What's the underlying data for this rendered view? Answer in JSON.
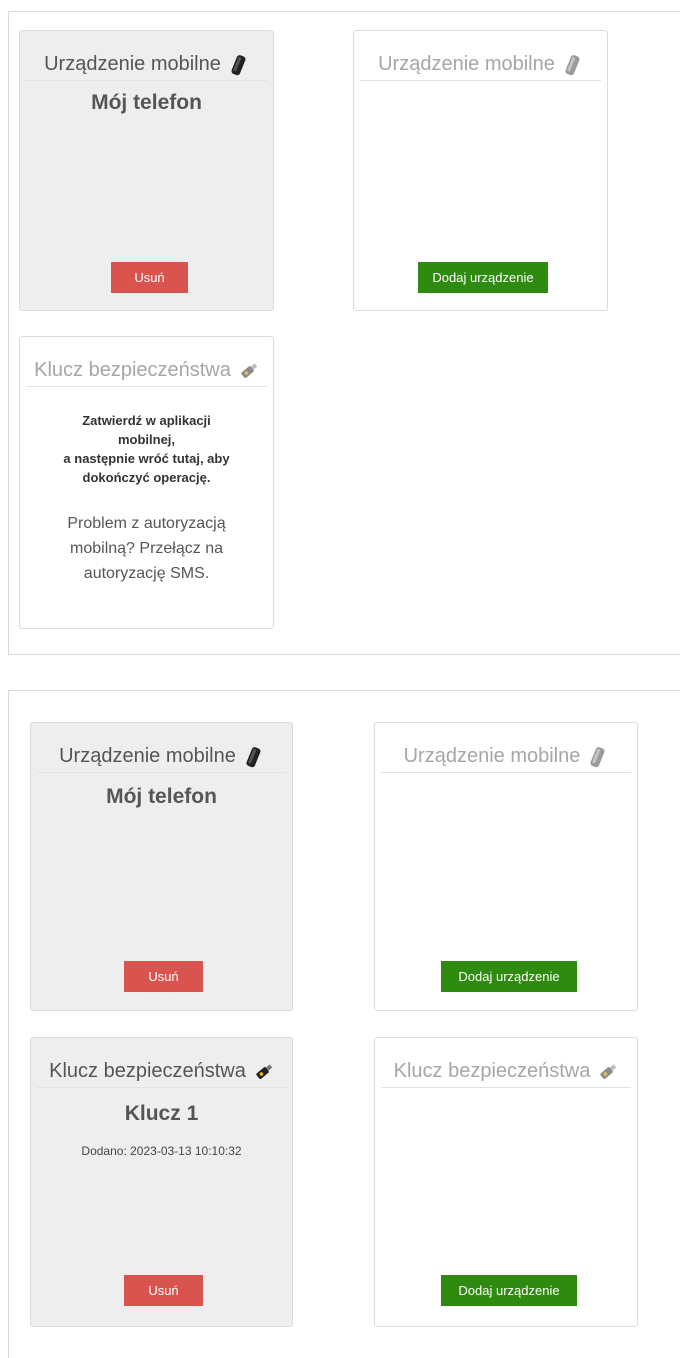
{
  "panel1": {
    "mobile_registered": {
      "header": "Urządzenie mobilne",
      "icon": "phone-icon",
      "name": "Mój telefon",
      "remove_label": "Usuń"
    },
    "mobile_empty": {
      "header": "Urządzenie mobilne",
      "icon": "phone-icon",
      "add_label": "Dodaj urządzenie"
    },
    "security_key_pending": {
      "header": "Klucz bezpieczeństwa",
      "icon": "usb-key-icon",
      "confirm_lines": [
        "Zatwierdź w aplikacji",
        "mobilnej,",
        "a następnie wróć tutaj, aby",
        "dokończyć operację."
      ],
      "sms_lines": [
        "Problem z autoryzacją",
        "mobilną? Przełącz na",
        "autoryzację SMS."
      ]
    }
  },
  "panel2": {
    "mobile_registered": {
      "header": "Urządzenie mobilne",
      "icon": "phone-icon",
      "name": "Mój telefon",
      "remove_label": "Usuń"
    },
    "mobile_empty": {
      "header": "Urządzenie mobilne",
      "icon": "phone-icon",
      "add_label": "Dodaj urządzenie"
    },
    "security_key_registered": {
      "header": "Klucz bezpieczeństwa",
      "icon": "usb-key-icon",
      "name": "Klucz 1",
      "added": "Dodano: 2023-03-13 10:10:32",
      "remove_label": "Usuń"
    },
    "security_key_empty": {
      "header": "Klucz bezpieczeństwa",
      "icon": "usb-key-icon",
      "add_label": "Dodaj urządzenie"
    }
  },
  "colors": {
    "remove_button": "#d9534f",
    "add_button": "#2e8b0f",
    "active_card": "#eeeeee",
    "muted_text": "#a6a6a6"
  }
}
